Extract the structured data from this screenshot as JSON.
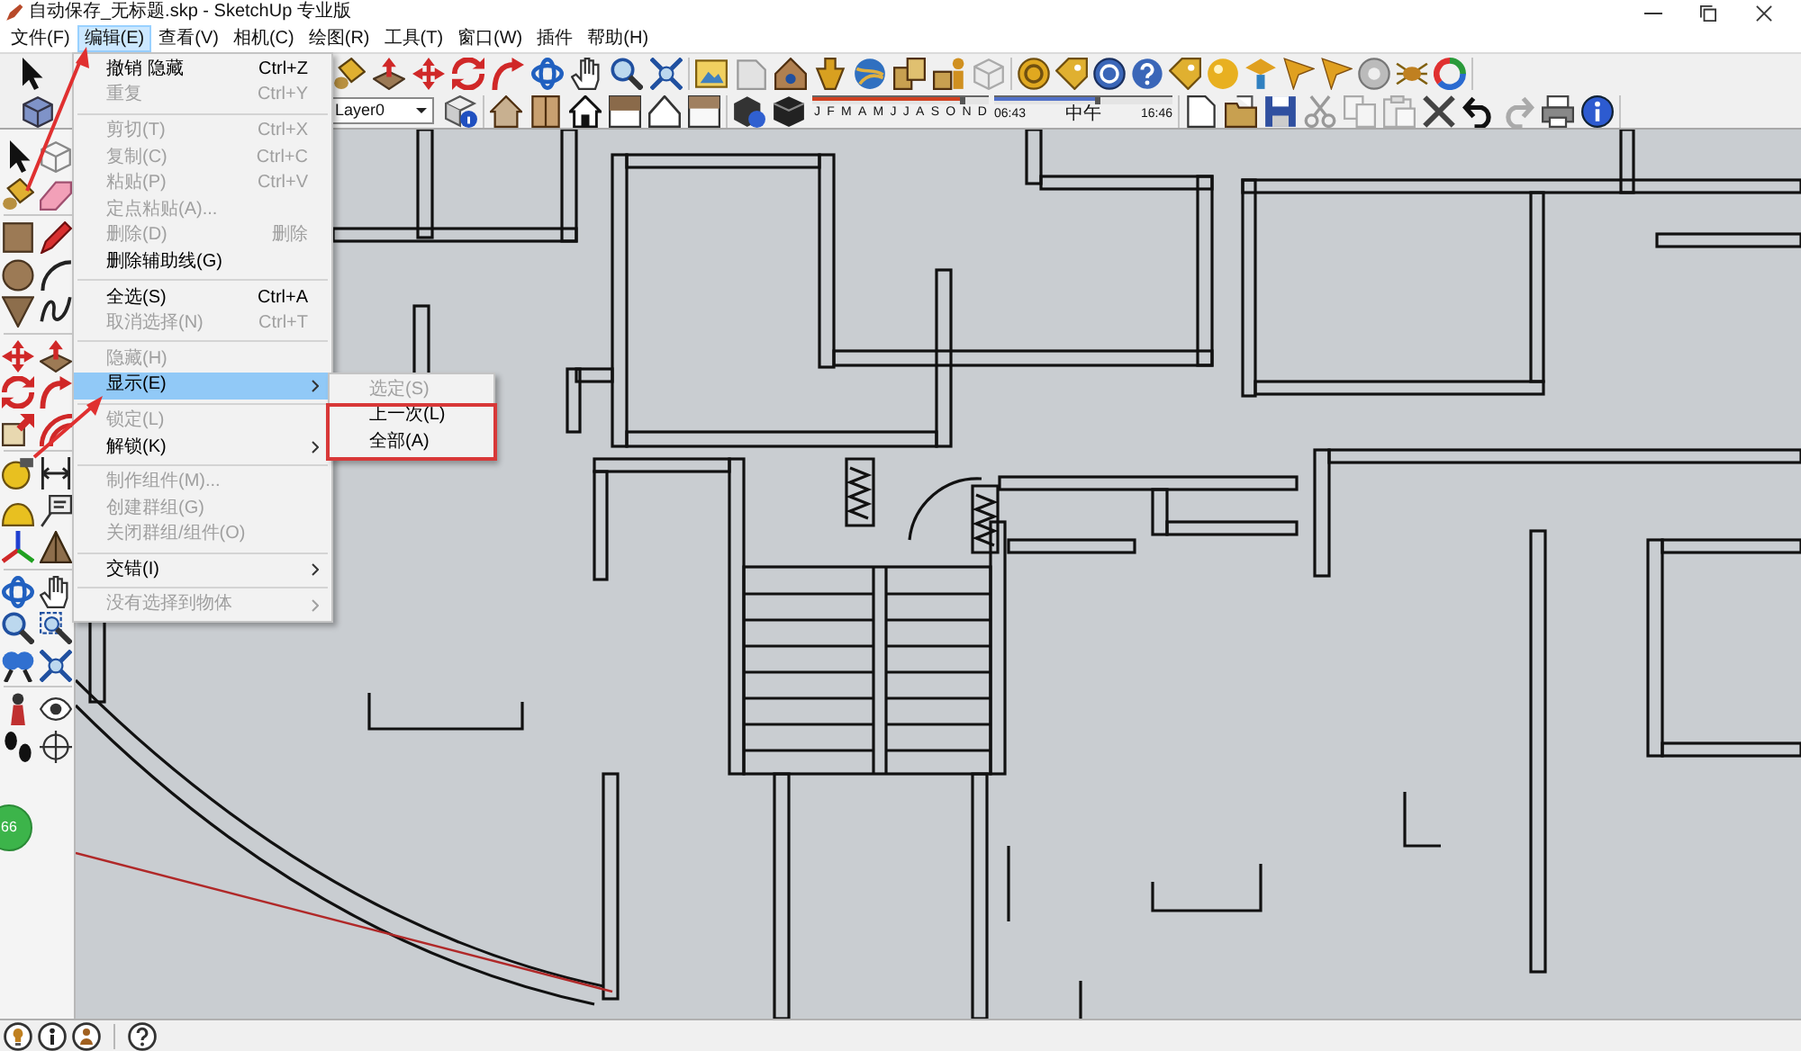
{
  "window": {
    "title": "自动保存_无标题.skp - SketchUp 专业版"
  },
  "menu_bar": [
    {
      "label": "文件(F)",
      "selected": false
    },
    {
      "label": "编辑(E)",
      "selected": true
    },
    {
      "label": "查看(V)",
      "selected": false
    },
    {
      "label": "相机(C)",
      "selected": false
    },
    {
      "label": "绘图(R)",
      "selected": false
    },
    {
      "label": "工具(T)",
      "selected": false
    },
    {
      "label": "窗口(W)",
      "selected": false
    },
    {
      "label": "插件",
      "selected": false
    },
    {
      "label": "帮助(H)",
      "selected": false
    }
  ],
  "layer_dropdown": {
    "value": "Layer0"
  },
  "shadow_settings": {
    "months": [
      "J",
      "F",
      "M",
      "A",
      "M",
      "J",
      "J",
      "A",
      "S",
      "O",
      "N",
      "D"
    ],
    "date": {
      "level": 0.85
    },
    "time": {
      "level": 0.58
    },
    "start_time": "06:43",
    "noon": "中午",
    "end_time": "16:46"
  },
  "edit_menu": [
    {
      "kind": "item",
      "label": "撤销 隐藏",
      "shortcut": "Ctrl+Z",
      "disabled": false,
      "selected": false,
      "submenu": false
    },
    {
      "kind": "item",
      "label": "重复",
      "shortcut": "Ctrl+Y",
      "disabled": true,
      "selected": false,
      "submenu": false
    },
    {
      "kind": "separator"
    },
    {
      "kind": "item",
      "label": "剪切(T)",
      "shortcut": "Ctrl+X",
      "disabled": true,
      "selected": false,
      "submenu": false
    },
    {
      "kind": "item",
      "label": "复制(C)",
      "shortcut": "Ctrl+C",
      "disabled": true,
      "selected": false,
      "submenu": false
    },
    {
      "kind": "item",
      "label": "粘贴(P)",
      "shortcut": "Ctrl+V",
      "disabled": true,
      "selected": false,
      "submenu": false
    },
    {
      "kind": "item",
      "label": "定点粘贴(A)...",
      "disabled": true,
      "selected": false,
      "submenu": false
    },
    {
      "kind": "item",
      "label": "删除(D)",
      "shortcut": "删除",
      "disabled": true,
      "selected": false,
      "submenu": false
    },
    {
      "kind": "item",
      "label": "删除辅助线(G)",
      "disabled": false,
      "selected": false,
      "submenu": false
    },
    {
      "kind": "separator"
    },
    {
      "kind": "item",
      "label": "全选(S)",
      "shortcut": "Ctrl+A",
      "disabled": false,
      "selected": false,
      "submenu": false
    },
    {
      "kind": "item",
      "label": "取消选择(N)",
      "shortcut": "Ctrl+T",
      "disabled": true,
      "selected": false,
      "submenu": false
    },
    {
      "kind": "separator"
    },
    {
      "kind": "item",
      "label": "隐藏(H)",
      "disabled": true,
      "selected": false,
      "submenu": false
    },
    {
      "kind": "item",
      "label": "显示(E)",
      "disabled": false,
      "selected": true,
      "submenu": true
    },
    {
      "kind": "separator"
    },
    {
      "kind": "item",
      "label": "锁定(L)",
      "disabled": true,
      "selected": false,
      "submenu": false
    },
    {
      "kind": "item",
      "label": "解锁(K)",
      "disabled": false,
      "selected": false,
      "submenu": true
    },
    {
      "kind": "separator"
    },
    {
      "kind": "item",
      "label": "制作组件(M)...",
      "disabled": true,
      "selected": false,
      "submenu": false
    },
    {
      "kind": "item",
      "label": "创建群组(G)",
      "disabled": true,
      "selected": false,
      "submenu": false
    },
    {
      "kind": "item",
      "label": "关闭群组/组件(O)",
      "disabled": true,
      "selected": false,
      "submenu": false
    },
    {
      "kind": "separator"
    },
    {
      "kind": "item",
      "label": "交错(I)",
      "disabled": false,
      "selected": false,
      "submenu": true
    },
    {
      "kind": "separator"
    },
    {
      "kind": "item",
      "label": "没有选择到物体",
      "disabled": true,
      "selected": false,
      "submenu": true
    }
  ],
  "show_submenu": [
    {
      "label": "选定(S)",
      "disabled": true,
      "selected": false
    },
    {
      "label": "上一次(L)",
      "disabled": false,
      "selected": false
    },
    {
      "label": "全部(A)",
      "disabled": false,
      "selected": false
    }
  ],
  "badge": {
    "text": "66"
  }
}
